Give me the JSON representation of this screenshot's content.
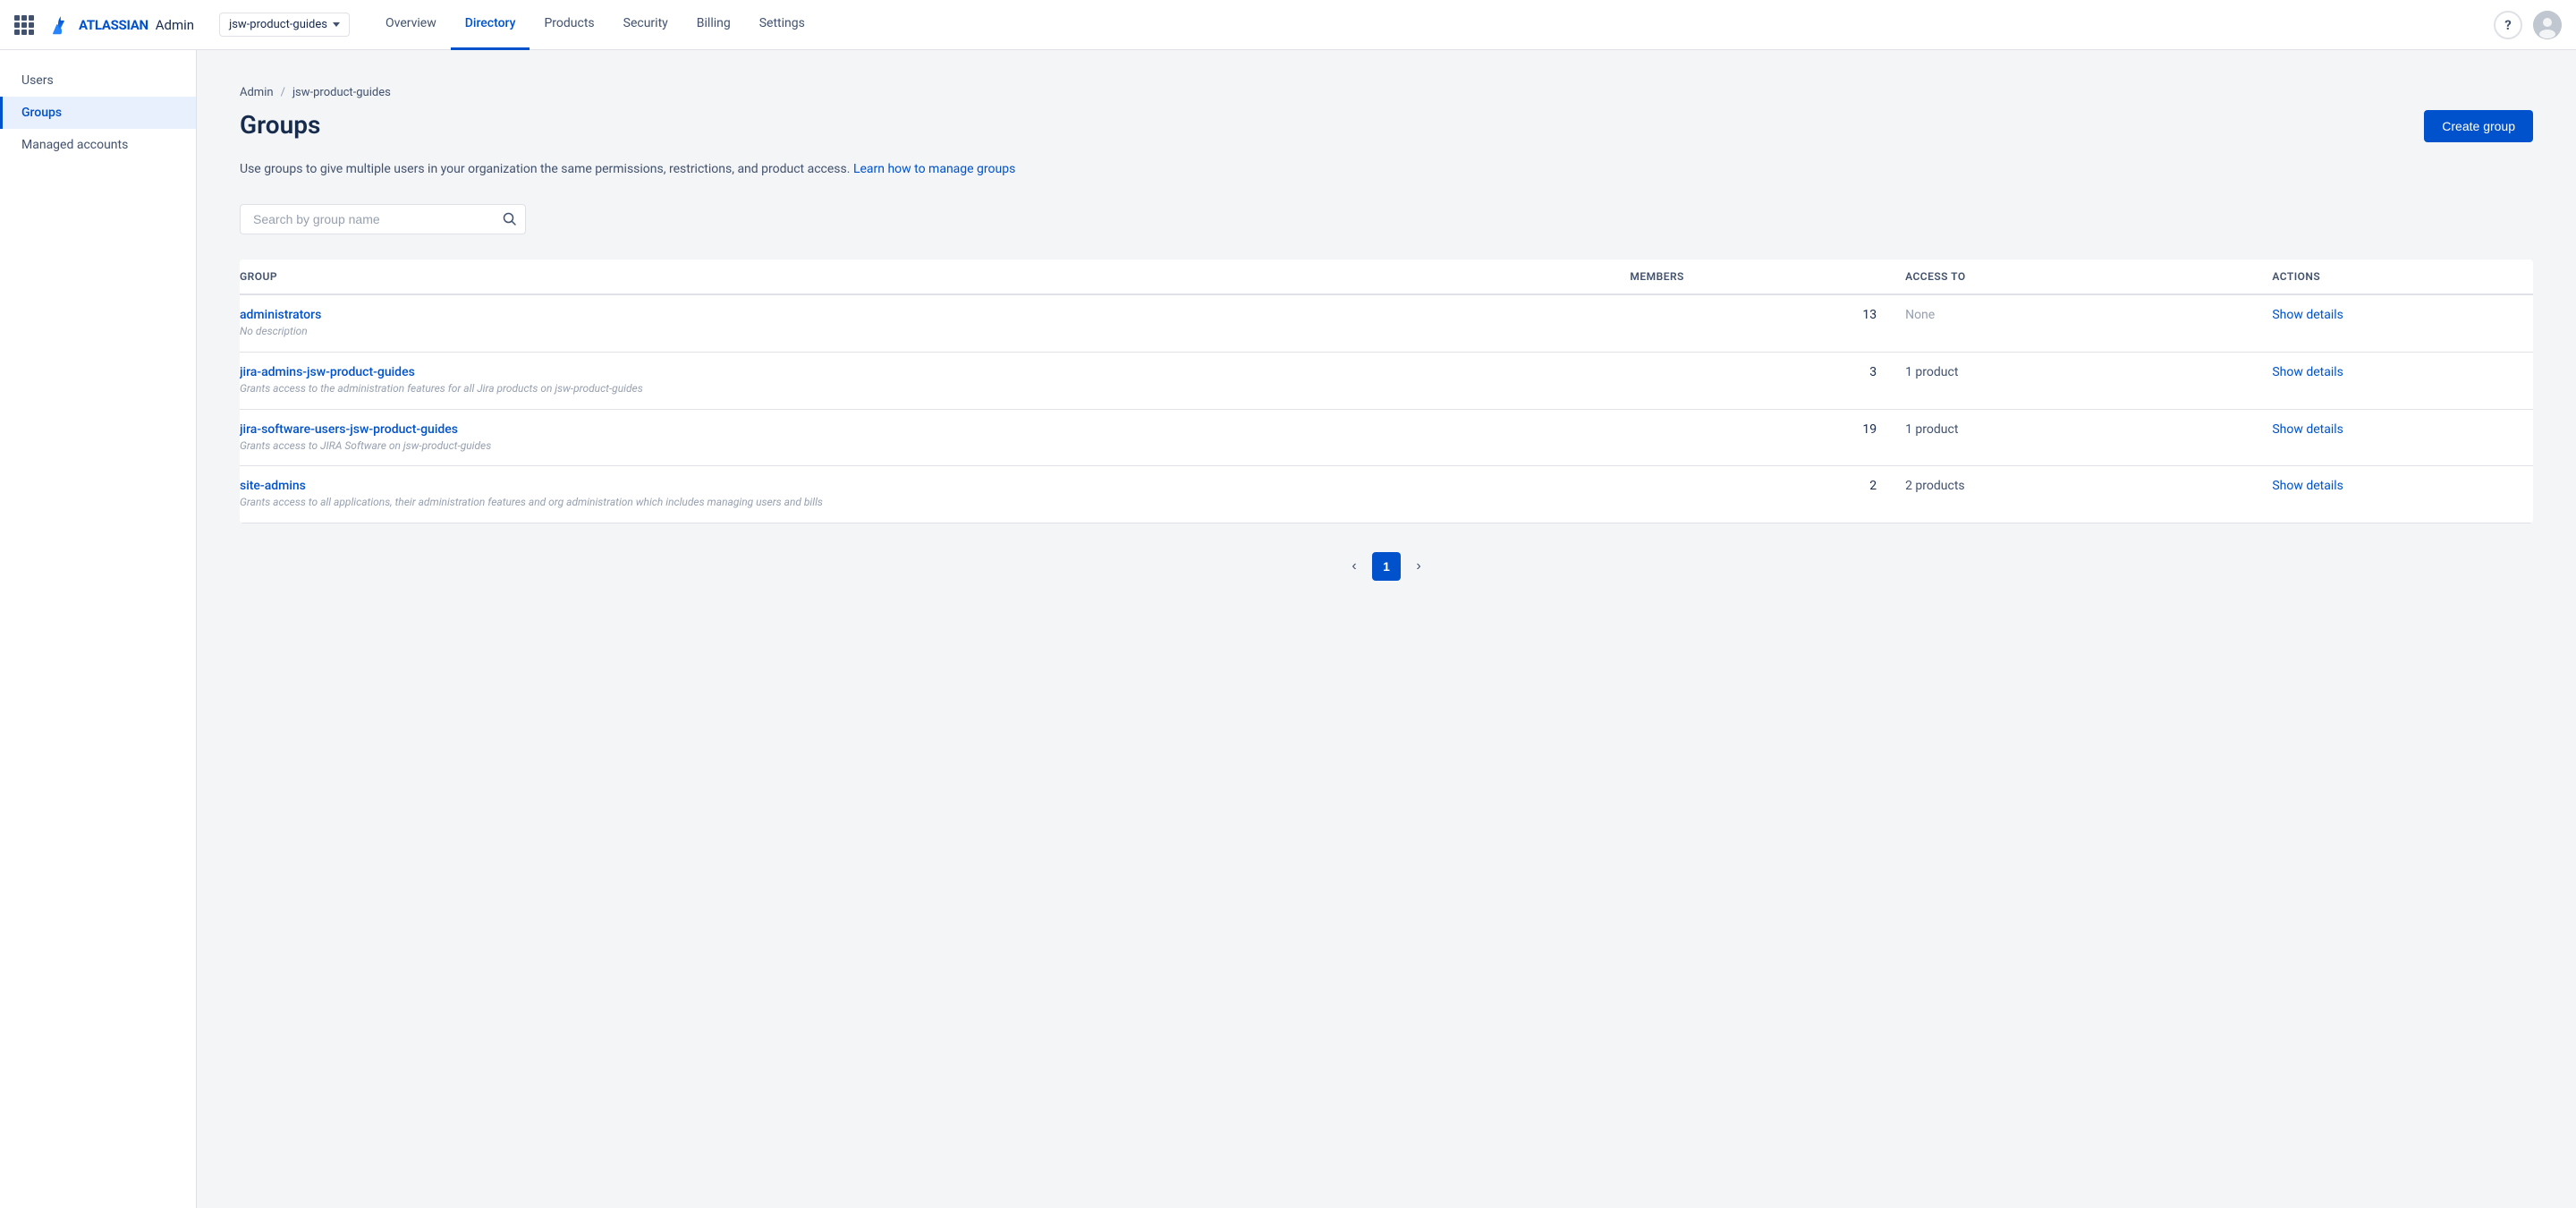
{
  "topnav": {
    "logo_text": "ATLASSIAN",
    "admin_label": "Admin",
    "org_name": "jsw-product-guides",
    "links": [
      {
        "id": "overview",
        "label": "Overview",
        "active": false
      },
      {
        "id": "directory",
        "label": "Directory",
        "active": true
      },
      {
        "id": "products",
        "label": "Products",
        "active": false
      },
      {
        "id": "security",
        "label": "Security",
        "active": false
      },
      {
        "id": "billing",
        "label": "Billing",
        "active": false
      },
      {
        "id": "settings",
        "label": "Settings",
        "active": false
      }
    ],
    "help_label": "?",
    "avatar_initials": ""
  },
  "sidebar": {
    "items": [
      {
        "id": "users",
        "label": "Users",
        "active": false
      },
      {
        "id": "groups",
        "label": "Groups",
        "active": true
      },
      {
        "id": "managed-accounts",
        "label": "Managed accounts",
        "active": false
      }
    ]
  },
  "breadcrumb": {
    "admin_label": "Admin",
    "separator": "/",
    "org_label": "jsw-product-guides"
  },
  "page": {
    "title": "Groups",
    "create_button_label": "Create group",
    "description": "Use groups to give multiple users in your organization the same permissions, restrictions, and product access.",
    "learn_link_label": "Learn how to manage groups",
    "search_placeholder": "Search by group name"
  },
  "table": {
    "headers": {
      "group": "Group",
      "members": "Members",
      "access_to": "Access to",
      "actions": "Actions"
    },
    "rows": [
      {
        "name": "administrators",
        "description": "No description",
        "members": 13,
        "access": "None",
        "access_type": "none",
        "action_label": "Show details"
      },
      {
        "name": "jira-admins-jsw-product-guides",
        "description": "Grants access to the administration features for all Jira products on jsw-product-guides",
        "members": 3,
        "access": "1 product",
        "access_type": "product",
        "action_label": "Show details"
      },
      {
        "name": "jira-software-users-jsw-product-guides",
        "description": "Grants access to JIRA Software on jsw-product-guides",
        "members": 19,
        "access": "1 product",
        "access_type": "product",
        "action_label": "Show details"
      },
      {
        "name": "site-admins",
        "description": "Grants access to all applications, their administration features and org administration which includes managing users and bills",
        "members": 2,
        "access": "2 products",
        "access_type": "product",
        "action_label": "Show details"
      }
    ]
  },
  "pagination": {
    "prev_label": "‹",
    "next_label": "›",
    "current_page": 1,
    "pages": [
      1
    ]
  }
}
